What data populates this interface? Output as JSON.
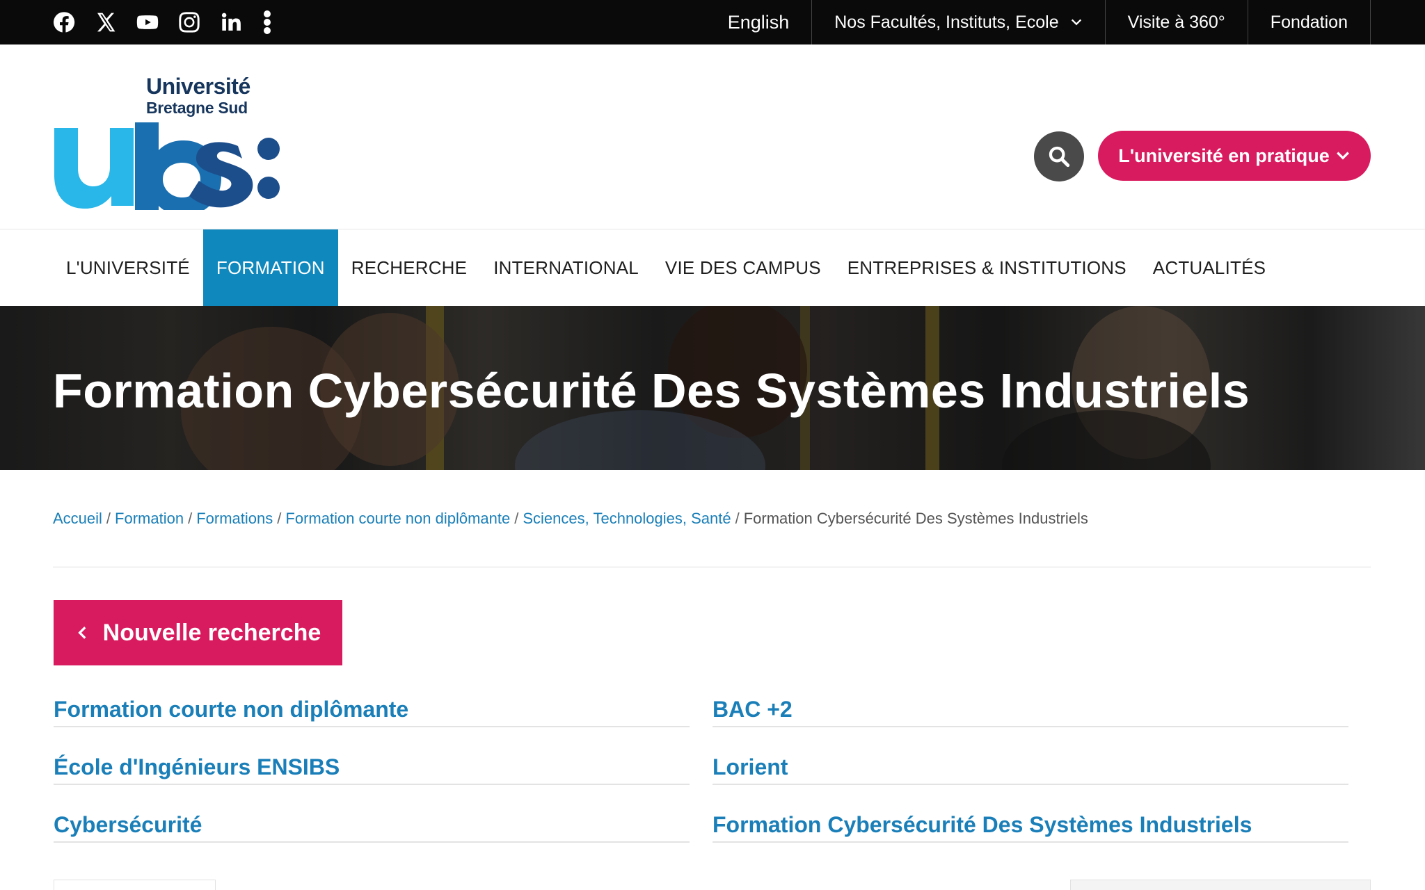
{
  "topbar": {
    "social": [
      {
        "name": "facebook-icon"
      },
      {
        "name": "x-icon"
      },
      {
        "name": "youtube-icon"
      },
      {
        "name": "instagram-icon"
      },
      {
        "name": "linkedin-icon"
      },
      {
        "name": "more-icon"
      }
    ],
    "language": "English",
    "faculties": "Nos Facultés, Instituts, Ecole",
    "visit": "Visite à 360°",
    "foundation": "Fondation"
  },
  "header": {
    "logo": {
      "line1": "Université",
      "line2": "Bretagne Sud"
    },
    "practice_label": "L'université en pratique"
  },
  "mainnav": {
    "items": [
      {
        "label": "L'UNIVERSITÉ"
      },
      {
        "label": "FORMATION"
      },
      {
        "label": "RECHERCHE"
      },
      {
        "label": "INTERNATIONAL"
      },
      {
        "label": "VIE DES CAMPUS"
      },
      {
        "label": "ENTREPRISES & INSTITUTIONS"
      },
      {
        "label": "ACTUALITÉS"
      }
    ],
    "active": "FORMATION"
  },
  "hero": {
    "title": "Formation Cybersécurité Des Systèmes Industriels"
  },
  "breadcrumb": {
    "items": [
      {
        "label": "Accueil"
      },
      {
        "label": "Formation"
      },
      {
        "label": "Formations"
      },
      {
        "label": "Formation courte non diplômante"
      },
      {
        "label": "Sciences, Technologies, Santé"
      }
    ],
    "current": "Formation Cybersécurité Des Systèmes Industriels",
    "separator": "/"
  },
  "content": {
    "new_search_label": "Nouvelle recherche",
    "tags": [
      {
        "label": "Formation courte non diplômante"
      },
      {
        "label": "BAC +2"
      },
      {
        "label": "École d'Ingénieurs ENSIBS"
      },
      {
        "label": "Lorient"
      },
      {
        "label": "Cybersécurité"
      },
      {
        "label": "Formation Cybersécurité Des Systèmes Industriels"
      }
    ]
  },
  "colors": {
    "topbar_bg": "#0a0a0a",
    "accent_pink": "#d81b5e",
    "accent_blue": "#0e88bd",
    "link_blue": "#1a7fb8",
    "logo_navy": "#17365d",
    "logo_cyan": "#29b6e8"
  }
}
